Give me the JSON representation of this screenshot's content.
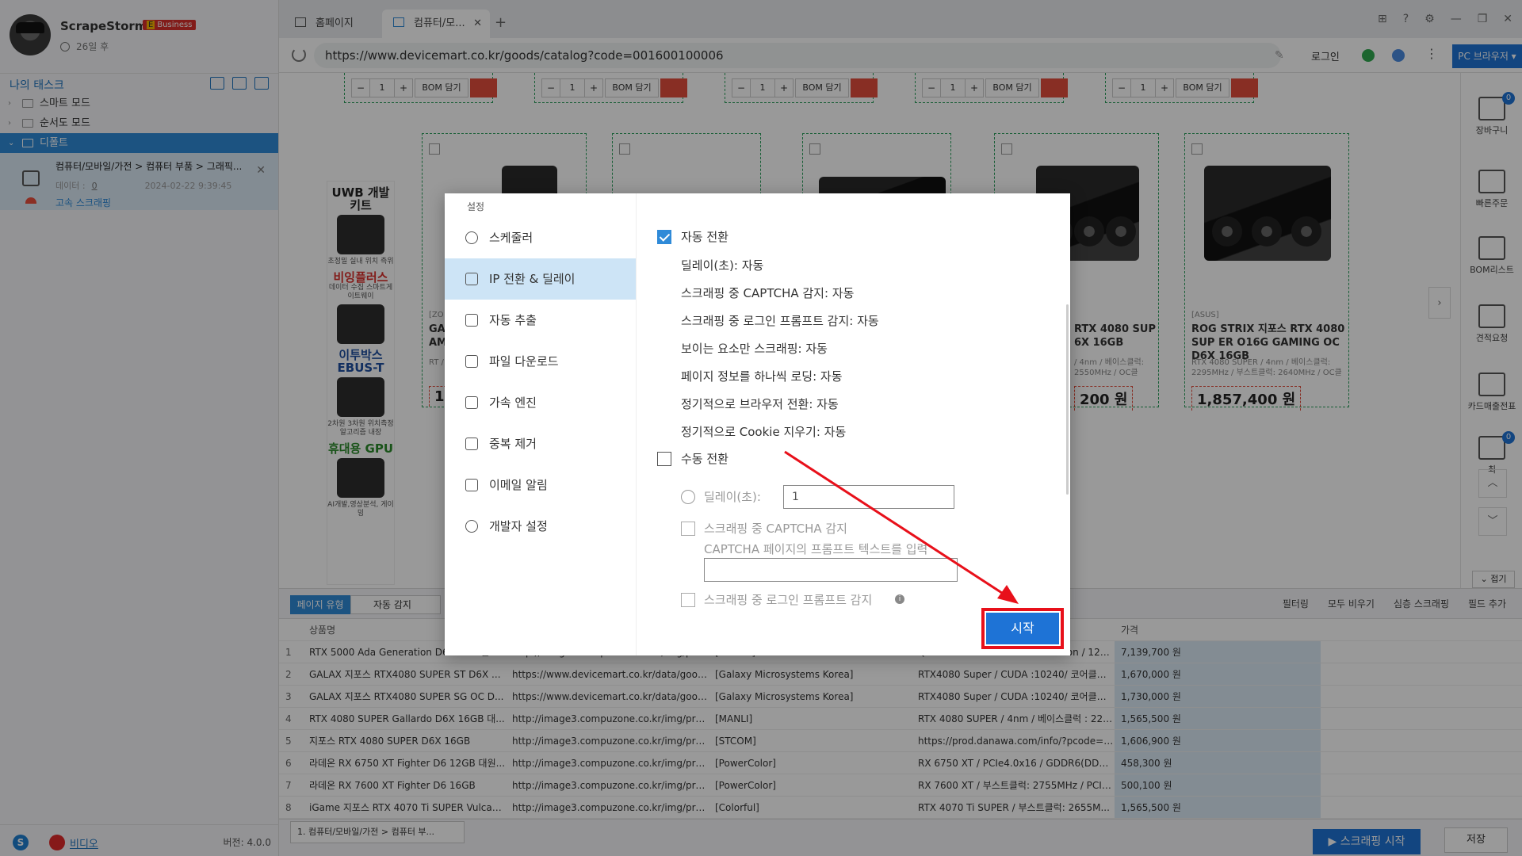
{
  "app": {
    "name": "ScrapeStorm",
    "plan_badge": "Business",
    "plan_prefix": "E",
    "expiry": "26일 후",
    "version": "버전: 4.0.0",
    "video_link": "비디오",
    "skype_glyph": "S"
  },
  "sidebar": {
    "tasks_header": "나의 태스크",
    "tree": [
      {
        "label": "스마트 모드"
      },
      {
        "label": "순서도 모드"
      },
      {
        "label": "디폴트"
      }
    ],
    "task": {
      "title": "컴퓨터/모바일/가전 > 컴퓨터 부품 > 그래픽...",
      "data_label": "데이터 :",
      "count": "0",
      "date": "2024-02-22 9:39:45",
      "mode": "고속 스크래핑"
    }
  },
  "tabs": {
    "home": "홈페이지",
    "current": "컴퓨터/모..."
  },
  "address": {
    "url": "https://www.devicemart.co.kr/goods/catalog?code=001600100006",
    "login": "로그인",
    "browser": "PC 브라우저 ▾"
  },
  "webpage": {
    "bom_label": "BOM 담기",
    "qty": "1",
    "banner": [
      {
        "h": "UWB 개발 키트",
        "s": "초정밀 실내 위치 측위"
      },
      {
        "h": "비잉플러스",
        "s": "데이터 수집 스마트게이트웨이"
      },
      {
        "h": "이투박스 EBUS-T",
        "s": "2차원 3차원 위치측정 알고리즘 내장"
      },
      {
        "h": "휴대용 GPU",
        "s": "AI개발,영상분석, 게이밍"
      }
    ],
    "products": [
      {
        "title": "GA AM",
        "spec": "RT /",
        "brand": "[ZO",
        "price": "1"
      },
      {
        "title": "RTX 4080 SUP 6X 16GB",
        "spec": "/ 4nm / 베이스클럭: 2550MHz / OC클",
        "brand": "",
        "price": "200 원"
      },
      {
        "title": "ROG STRIX 지포스 RTX 4080 SUP ER O16G GAMING OC D6X 16GB",
        "spec": "RTX 4080 SUPER / 4nm / 베이스클럭: 2295MHz / 부스트클럭: 2640MHz / OC클",
        "brand": "[ASUS]",
        "price": "1,857,400 원"
      }
    ]
  },
  "rail": {
    "items": [
      {
        "label": "장바구니",
        "badge": "0"
      },
      {
        "label": "빠른주문"
      },
      {
        "label": "BOM리스트"
      },
      {
        "label": "견적요청"
      },
      {
        "label": "카드매출전표"
      },
      {
        "label": "최",
        "badge": "0"
      }
    ],
    "up": "︿",
    "down": "﹀",
    "collapse": "⌄ 접기"
  },
  "datapanel": {
    "pagetype_btn": "페이지 유형",
    "pagetype_value": "자동 감지",
    "actions": [
      "필터링",
      "모두 비우기",
      "심층 스크래핑",
      "필드 추가"
    ],
    "columns": [
      "상품명",
      "",
      "",
      "",
      "가격"
    ],
    "rows": [
      [
        "1",
        "RTX 5000 Ada Generation D6 32GB 엔비...",
        "http://image3.compuzone.co.kr/img/product...",
        "[NVIDIA]",
        "Quadro RTX 5000 Ada Generation / 12800...",
        "7,139,700 원"
      ],
      [
        "2",
        "GALAX 지포스 RTX4080 SUPER ST D6X ...",
        "https://www.devicemart.co.kr/data/goods/1/...",
        "[Galaxy Microsystems Korea]",
        "RTX4080 Super / CUDA :10240/ 코어클럭:...",
        "1,670,000 원"
      ],
      [
        "3",
        "GALAX 지포스 RTX4080 SUPER SG OC D...",
        "https://www.devicemart.co.kr/data/goods/1/...",
        "[Galaxy Microsystems Korea]",
        "RTX4080 Super / CUDA :10240/ 코어클럭:...",
        "1,730,000 원"
      ],
      [
        "4",
        "RTX 4080 SUPER Gallardo D6X 16GB 대...",
        "http://image3.compuzone.co.kr/img/product...",
        "[MANLI]",
        "RTX 4080 SUPER / 4nm / 베이스클럭 : 229...",
        "1,565,500 원"
      ],
      [
        "5",
        "지포스 RTX 4080 SUPER D6X 16GB",
        "http://image3.compuzone.co.kr/img/product...",
        "[STCOM]",
        "https://prod.danawa.com/info/?pcode=3399...",
        "1,606,900 원"
      ],
      [
        "6",
        "라데온 RX 6750 XT Fighter D6 12GB 대원...",
        "http://image3.compuzone.co.kr/img/product...",
        "[PowerColor]",
        "RX 6750 XT / PCIe4.0x16 / GDDR6(DDR6)...",
        "458,300 원"
      ],
      [
        "7",
        "라데온 RX 7600 XT Fighter D6 16GB",
        "http://image3.compuzone.co.kr/img/product...",
        "[PowerColor]",
        "RX 7600 XT / 부스트클럭: 2755MHz / PCIe...",
        "500,100 원"
      ],
      [
        "8",
        "iGame 지포스 RTX 4070 Ti SUPER Vulcan...",
        "http://image3.compuzone.co.kr/img/product...",
        "[Colorful]",
        "RTX 4070 Ti SUPER / 부스트클럭: 2655M...",
        "1,565,500 원"
      ]
    ],
    "page_tab": "1. 컴퓨터/모바일/가전 > 컴퓨터 부...",
    "start_scrape": "▶ 스크래핑 시작",
    "save": "저장"
  },
  "modal": {
    "title": "설정",
    "nav": [
      "스케줄러",
      "IP 전환 & 딜레이",
      "자동 추출",
      "파일 다운로드",
      "가속 엔진",
      "중복 제거",
      "이메일 알림",
      "개발자 설정"
    ],
    "auto_switch": "자동 전환",
    "auto_options": [
      "딜레이(초): 자동",
      "스크래핑 중 CAPTCHA 감지: 자동",
      "스크래핑 중 로그인 프롬프트 감지: 자동",
      "보이는 요소만 스크래핑: 자동",
      "페이지 정보를 하나씩 로딩: 자동",
      "정기적으로 브라우저 전환: 자동",
      "정기적으로 Cookie 지우기: 자동"
    ],
    "manual_switch": "수동 전환",
    "delay_label": "딜레이(초):",
    "delay_value": "1",
    "captcha_label": "스크래핑 중 CAPTCHA 감지",
    "captcha_prompt": "CAPTCHA 페이지의 프롬프트 텍스트를 입력",
    "login_label": "스크래핑 중 로그인 프롬프트 감지",
    "start_button": "시작"
  }
}
